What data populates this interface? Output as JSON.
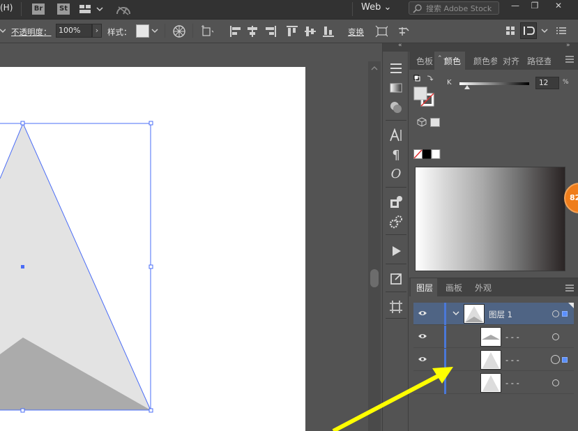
{
  "menubar": {
    "menu_h": "(H)",
    "apps": [
      "Br",
      "St"
    ],
    "workspace": "Web",
    "search_placeholder": "搜索 Adobe Stock",
    "window_buttons": [
      "—",
      "❐",
      "✕"
    ]
  },
  "controlbar": {
    "opacity_label": "不透明度：",
    "opacity_value": "100%",
    "style_label": "样式：",
    "transform_label": "变换"
  },
  "color_panel": {
    "tabs": [
      "色板",
      "颜色",
      "颜色参",
      "对齐",
      "路径查"
    ],
    "active_tab": "颜色",
    "channel_label": "K",
    "k_value": "12",
    "percent": "%"
  },
  "layers_panel": {
    "tabs": [
      "图层",
      "画板",
      "外观"
    ],
    "active_tab": "图层",
    "layer_name": "图层 1",
    "sublayers": [
      "- - -",
      "- - -",
      "- - -"
    ]
  },
  "badge": {
    "text": "82"
  },
  "colors": {
    "accent": "#4a78d8",
    "selection_row": "#4f6484",
    "badge": "#ef7d1b",
    "arrow": "#ffff00"
  }
}
